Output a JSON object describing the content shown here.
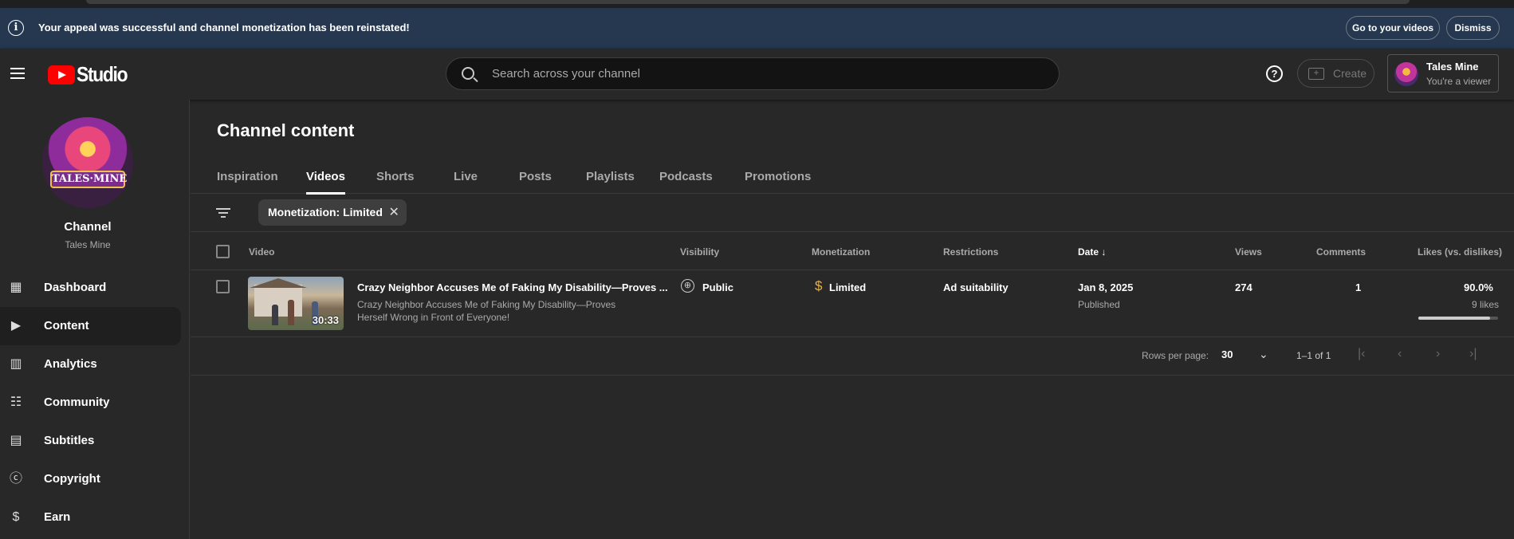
{
  "banner": {
    "message": "Your appeal was successful and channel monetization has been reinstated!",
    "go_label": "Go to your videos",
    "dismiss_label": "Dismiss"
  },
  "header": {
    "logo_text": "Studio",
    "search_placeholder": "Search across your channel",
    "help_label": "?",
    "create_label": "Create",
    "account_name": "Tales Mine",
    "account_role": "You're a viewer"
  },
  "sidebar": {
    "channel_avatar_text": "TALES·MINE",
    "channel_label": "Channel",
    "channel_name": "Tales Mine",
    "items": [
      {
        "label": "Dashboard",
        "icon": "dashboard-icon",
        "glyph": "▦"
      },
      {
        "label": "Content",
        "icon": "content-icon",
        "glyph": "▶"
      },
      {
        "label": "Analytics",
        "icon": "analytics-icon",
        "glyph": "▥"
      },
      {
        "label": "Community",
        "icon": "community-icon",
        "glyph": "☷"
      },
      {
        "label": "Subtitles",
        "icon": "subtitles-icon",
        "glyph": "▤"
      },
      {
        "label": "Copyright",
        "icon": "copyright-icon",
        "glyph": "ⓒ"
      },
      {
        "label": "Earn",
        "icon": "earn-icon",
        "glyph": "$"
      }
    ],
    "active_index": 1
  },
  "main": {
    "title": "Channel content",
    "tabs": [
      "Inspiration",
      "Videos",
      "Shorts",
      "Live",
      "Posts",
      "Playlists",
      "Podcasts",
      "Promotions"
    ],
    "active_tab": "Videos",
    "filter_chip": "Monetization: Limited",
    "columns": {
      "video": "Video",
      "visibility": "Visibility",
      "monetization": "Monetization",
      "restrictions": "Restrictions",
      "date": "Date",
      "views": "Views",
      "comments": "Comments",
      "likes": "Likes (vs. dislikes)"
    },
    "rows": [
      {
        "title": "Crazy Neighbor Accuses Me of Faking My Disability—Proves ...",
        "description": "Crazy Neighbor Accuses Me of Faking My Disability—Proves Herself Wrong in Front of Everyone!",
        "duration": "30:33",
        "visibility": "Public",
        "monetization": "Limited",
        "restrictions": "Ad suitability",
        "date": "Jan 8, 2025",
        "date_status": "Published",
        "views": "274",
        "comments": "1",
        "likes_pct": "90.0%",
        "likes_count": "9 likes",
        "likes_fraction": 0.9
      }
    ],
    "pagination": {
      "rows_label": "Rows per page:",
      "rows_value": "30",
      "range": "1–1 of 1"
    }
  },
  "colors": {
    "banner_bg": "#263850",
    "youtube_red": "#ff0000",
    "monetization_limited": "#e8b24a"
  }
}
